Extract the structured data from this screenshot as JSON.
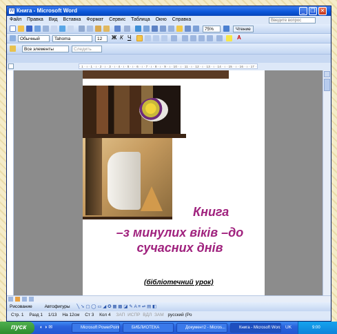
{
  "window": {
    "title": "Книга - Microsoft Word"
  },
  "menu": [
    "Файл",
    "Правка",
    "Вид",
    "Вставка",
    "Формат",
    "Сервис",
    "Таблица",
    "Окно",
    "Справка"
  ],
  "help_placeholder": "Введите вопрос",
  "toolbar": {
    "zoom": "75%",
    "read_button": "Чтение"
  },
  "format": {
    "style": "Обычный",
    "font": "Tahoma",
    "size": "12"
  },
  "reviewing": {
    "show": "Все элементы",
    "next": "Следить"
  },
  "ruler_text": "· 1 · ı · 1 · ı · 2 · ı · 3 · ı · 4 · ı · 5 · ı · 6 · ı · 7 · ı · 8 · ı · 9 · ı · 10 · ı · 11 · ı · 12 · ı · 13 · ı · 14 · ı · 15 · ı · 16 · ı · 17 · ı · 18 · ı",
  "document": {
    "heading": "Книга",
    "line1": "–з минулих віків –до",
    "line2": "сучасних днів",
    "subtitle": "(бібліотечний урок)"
  },
  "drawbar": {
    "draw": "Рисование",
    "autoshapes": "Автофигуры"
  },
  "statusbar": {
    "page": "Стр. 1",
    "section": "Разд 1",
    "pages": "1/13",
    "at": "На 12см",
    "line": "Ст 3",
    "col": "Кол 4",
    "rec": "ЗАП",
    "trk": "ИСПР",
    "ext": "ВДЛ",
    "ovr": "ЗАМ",
    "lang": "русский (Ро"
  },
  "taskbar": {
    "start": "пуск",
    "tasks": [
      "Microsoft PowerPoint ...",
      "БИБЛИОТЕКА",
      "Документ2 - Micros...",
      "Книга - Microsoft Word"
    ],
    "lang": "UK",
    "clock": "9:00"
  }
}
